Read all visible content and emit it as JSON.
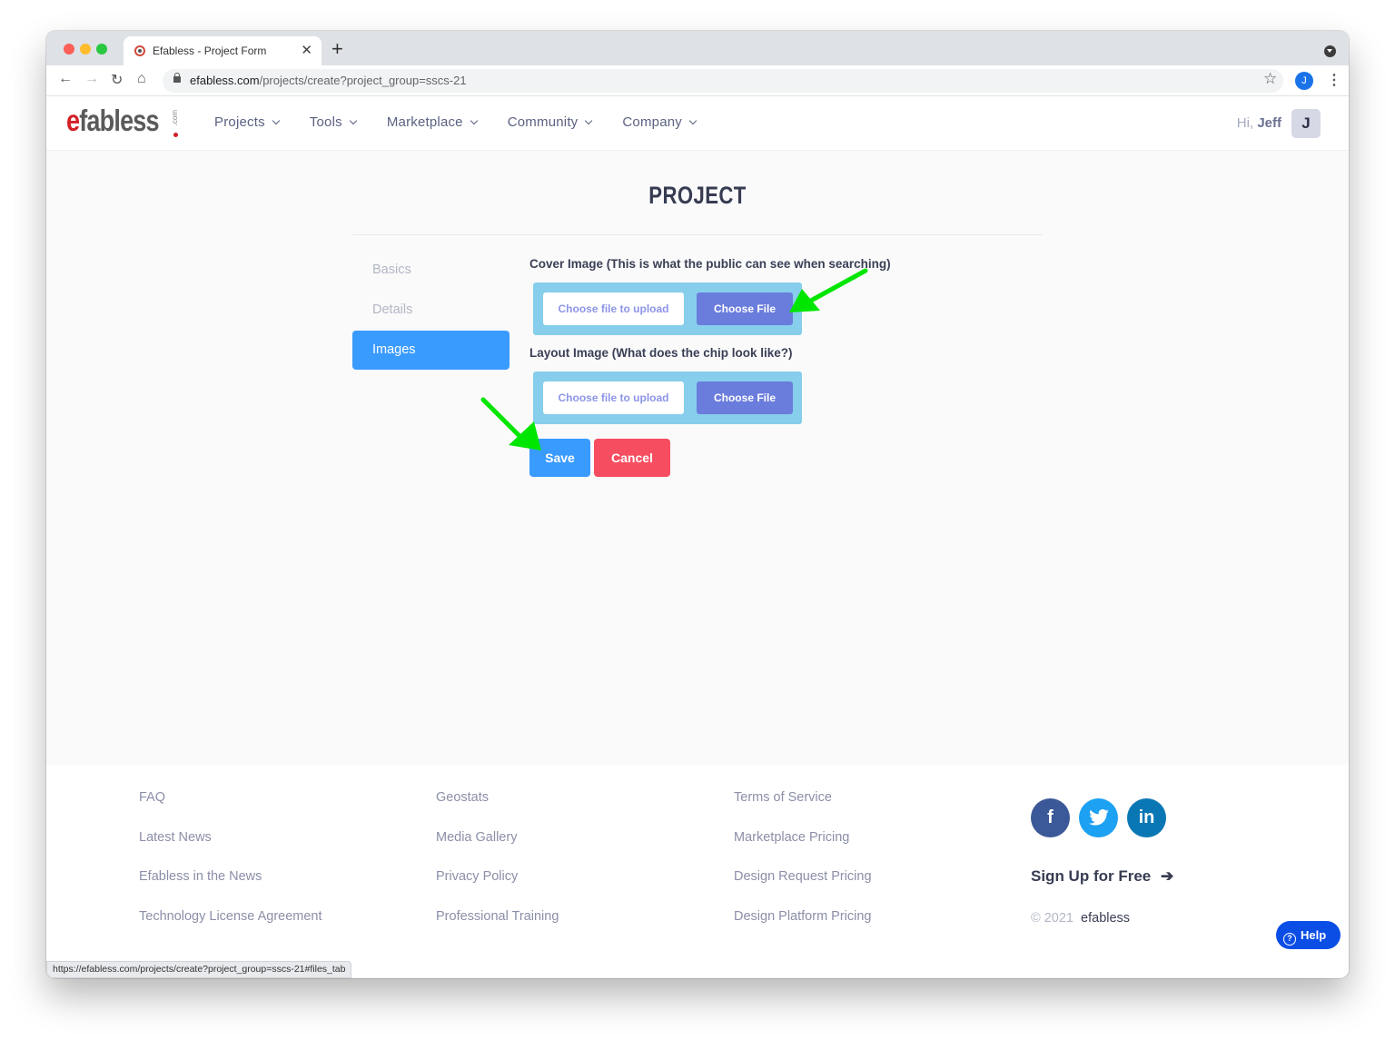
{
  "browser": {
    "tab_title": "Efabless - Project Form",
    "url_host": "efabless.com",
    "url_path": "/projects/create?project_group=sscs-21",
    "profile_initial": "J",
    "status_url": "https://efabless.com/projects/create?project_group=sscs-21#files_tab"
  },
  "header": {
    "logo_main": "fabless",
    "logo_e": "e",
    "logo_suffix": ".com",
    "nav": [
      {
        "label": "Projects"
      },
      {
        "label": "Tools"
      },
      {
        "label": "Marketplace"
      },
      {
        "label": "Community"
      },
      {
        "label": "Company"
      }
    ],
    "greeting_prefix": "Hi,",
    "user_name": "Jeff",
    "user_initial": "J"
  },
  "main": {
    "title": "PROJECT",
    "side_tabs": [
      {
        "label": "Basics",
        "active": false
      },
      {
        "label": "Details",
        "active": false
      },
      {
        "label": "Images",
        "active": true
      }
    ],
    "fields": [
      {
        "label": "Cover Image (This is what the public can see when searching)",
        "placeholder": "Choose file to upload",
        "button": "Choose File"
      },
      {
        "label": "Layout Image (What does the chip look like?)",
        "placeholder": "Choose file to upload",
        "button": "Choose File"
      }
    ],
    "save_label": "Save",
    "cancel_label": "Cancel"
  },
  "footer": {
    "col1": [
      "FAQ",
      "Latest News",
      "Efabless in the News",
      "Technology License Agreement"
    ],
    "col2": [
      "Geostats",
      "Media Gallery",
      "Privacy Policy",
      "Professional Training"
    ],
    "col3": [
      "Terms of Service",
      "Marketplace Pricing",
      "Design Request Pricing",
      "Design Platform Pricing"
    ],
    "social": {
      "facebook": "f",
      "twitter": "t",
      "linkedin": "in"
    },
    "signup_label": "Sign Up for Free",
    "copyright": "© 2021",
    "brand": "efabless",
    "help_label": "Help"
  },
  "colors": {
    "accent": "#3a9bff",
    "cancel": "#f64e60",
    "upload_box": "#86ceeb",
    "choose_button": "#6a7cdc",
    "annotation_arrow": "#00e600"
  }
}
